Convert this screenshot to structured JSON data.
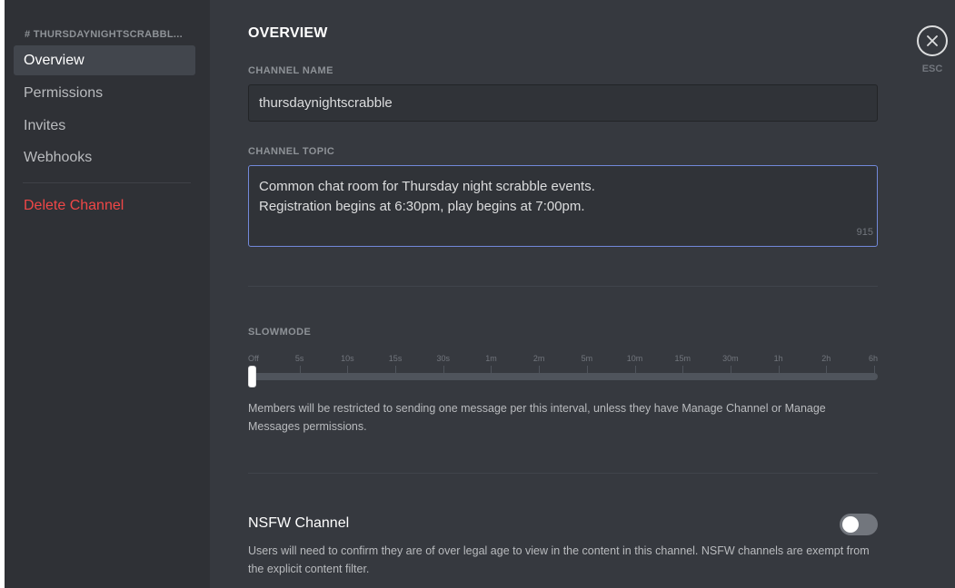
{
  "sidebar": {
    "header": "# THURSDAYNIGHTSCRABBL...",
    "items": [
      {
        "label": "Overview"
      },
      {
        "label": "Permissions"
      },
      {
        "label": "Invites"
      },
      {
        "label": "Webhooks"
      }
    ],
    "delete_label": "Delete Channel"
  },
  "main": {
    "title": "OVERVIEW",
    "channel_name": {
      "label": "CHANNEL NAME",
      "value": "thursdaynightscrabble"
    },
    "channel_topic": {
      "label": "CHANNEL TOPIC",
      "value": "Common chat room for Thursday night scrabble events.\nRegistration begins at 6:30pm, play begins at 7:00pm.",
      "remaining": "915"
    },
    "slowmode": {
      "label": "SLOWMODE",
      "ticks": [
        "Off",
        "5s",
        "10s",
        "15s",
        "30s",
        "1m",
        "2m",
        "5m",
        "10m",
        "15m",
        "30m",
        "1h",
        "2h",
        "6h"
      ],
      "selected_index": 0,
      "help": "Members will be restricted to sending one message per this interval, unless they have Manage Channel or Manage Messages permissions."
    },
    "nsfw": {
      "title": "NSFW Channel",
      "enabled": false,
      "help": "Users will need to confirm they are of over legal age to view in the content in this channel. NSFW channels are exempt from the explicit content filter."
    }
  },
  "close": {
    "icon": "close-icon",
    "label": "ESC"
  },
  "colors": {
    "accent": "#7289da",
    "danger": "#f04747",
    "background": "#36393f",
    "sidebar": "#2f3136"
  }
}
